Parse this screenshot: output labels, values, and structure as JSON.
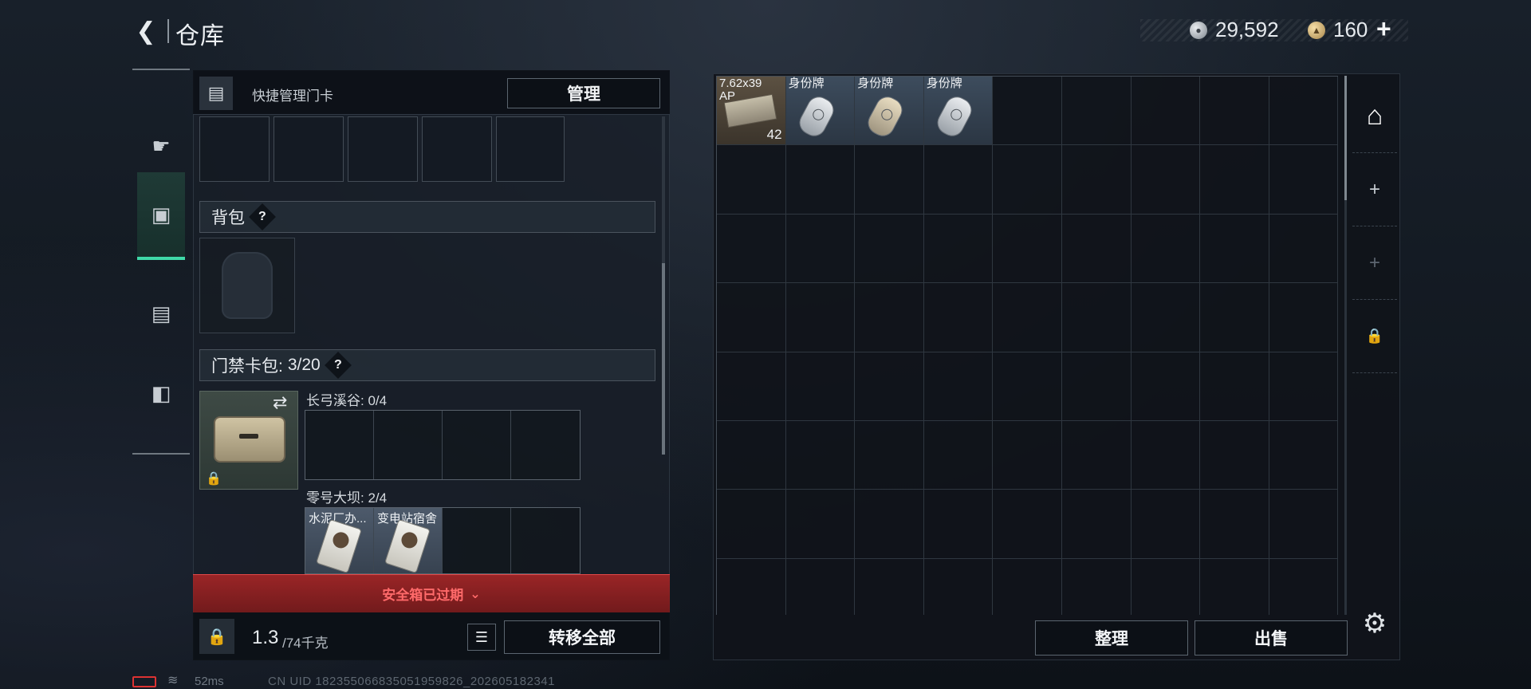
{
  "header": {
    "back_icon": "back-arrow-icon",
    "title": "仓库",
    "currency": {
      "money": "29,592",
      "coupons": "160",
      "plus": "+"
    }
  },
  "left_tabs": [
    {
      "name": "weapon",
      "icon": "pistol-icon",
      "active": false
    },
    {
      "name": "backpack-gear",
      "icon": "backpack-icon",
      "active": true
    },
    {
      "name": "card-pack",
      "icon": "card-pack-icon",
      "active": false
    },
    {
      "name": "toolbox",
      "icon": "briefcase-icon",
      "active": false
    }
  ],
  "loadout": {
    "quick_manage_label": "快捷管理门卡",
    "manage_button": "管理",
    "backpack_section": "背包",
    "card_pack_section": "门禁卡包:",
    "card_pack_count": "3/20",
    "help_mark": "?",
    "card_maps": [
      {
        "label": "长弓溪谷: 0/4",
        "cards": []
      },
      {
        "label": "零号大坝: 2/4",
        "cards": [
          "水泥厂办...",
          "变电站宿舍"
        ]
      }
    ],
    "expired_notice": "安全箱已过期",
    "weight_value": "1.3",
    "weight_max": "/74千克",
    "transfer_all": "转移全部"
  },
  "stash": {
    "items": [
      {
        "label": "7.62x39\nAP",
        "count": "42",
        "type": "ammo"
      },
      {
        "label": "身份牌",
        "type": "dogtag",
        "tint": "silver"
      },
      {
        "label": "身份牌",
        "type": "dogtag",
        "tint": "warm"
      },
      {
        "label": "身份牌",
        "type": "dogtag",
        "tint": "silver"
      }
    ],
    "side_tabs": [
      {
        "icon": "stash-home-icon",
        "active": true
      },
      {
        "icon": "add-icon",
        "active": false
      },
      {
        "icon": "add-icon",
        "active": false,
        "dim": true
      },
      {
        "icon": "lock-icon",
        "active": false
      }
    ],
    "sort_button": "整理",
    "sell_button": "出售"
  },
  "status_bar": {
    "ping": "52ms",
    "uid": "CN UID 18235506683505195982​6_202605182341"
  },
  "colors": {
    "accent_green": "#3fd9a8",
    "warning_red": "#ff6a6a",
    "panel_bg": "#181f28"
  }
}
